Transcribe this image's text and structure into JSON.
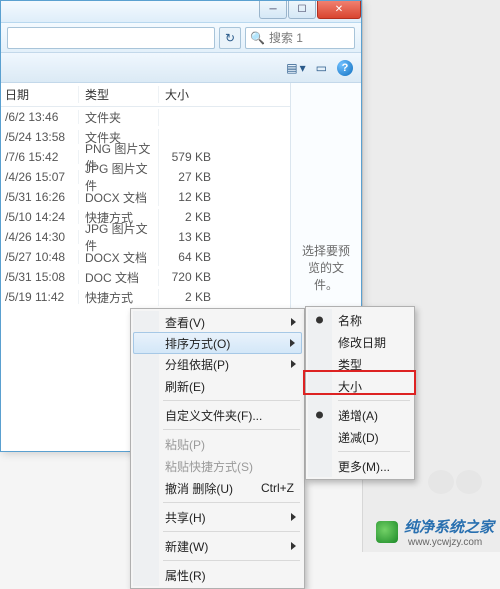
{
  "window": {
    "min_glyph": "─",
    "max_glyph": "☐",
    "close_glyph": "✕",
    "refresh_glyph": "↻",
    "search_placeholder": "搜索 1",
    "search_icon": "🔍",
    "view_icon": "▤",
    "dropdown_glyph": "▾",
    "preview_icon": "▭",
    "help_glyph": "?"
  },
  "columns": {
    "date": "日期",
    "type": "类型",
    "size": "大小"
  },
  "rows": [
    {
      "date": "/6/2 13:46",
      "type": "文件夹",
      "size": ""
    },
    {
      "date": "/5/24 13:58",
      "type": "文件夹",
      "size": ""
    },
    {
      "date": "/7/6 15:42",
      "type": "PNG 图片文件",
      "size": "579 KB"
    },
    {
      "date": "/4/26 15:07",
      "type": "JPG 图片文件",
      "size": "27 KB"
    },
    {
      "date": "/5/31 16:26",
      "type": "DOCX 文档",
      "size": "12 KB"
    },
    {
      "date": "/5/10 14:24",
      "type": "快捷方式",
      "size": "2 KB"
    },
    {
      "date": "/4/26 14:30",
      "type": "JPG 图片文件",
      "size": "13 KB"
    },
    {
      "date": "/5/27 10:48",
      "type": "DOCX 文档",
      "size": "64 KB"
    },
    {
      "date": "/5/31 15:08",
      "type": "DOC 文档",
      "size": "720 KB"
    },
    {
      "date": "/5/19 11:42",
      "type": "快捷方式",
      "size": "2 KB"
    }
  ],
  "preview_text": "选择要预览的文件。",
  "ctx": {
    "view": "查看(V)",
    "sort": "排序方式(O)",
    "group": "分组依据(P)",
    "refresh": "刷新(E)",
    "custom": "自定义文件夹(F)...",
    "paste": "粘贴(P)",
    "pasteshortcut": "粘贴快捷方式(S)",
    "undo": "撤消 删除(U)",
    "undo_accel": "Ctrl+Z",
    "share": "共享(H)",
    "new": "新建(W)",
    "props": "属性(R)"
  },
  "sub": {
    "name": "名称",
    "mdate": "修改日期",
    "type": "类型",
    "size": "大小",
    "asc": "递增(A)",
    "desc": "递减(D)",
    "more": "更多(M)..."
  },
  "watermark": {
    "title": "纯净系统之家",
    "url": "www.ycwjzy.com"
  }
}
